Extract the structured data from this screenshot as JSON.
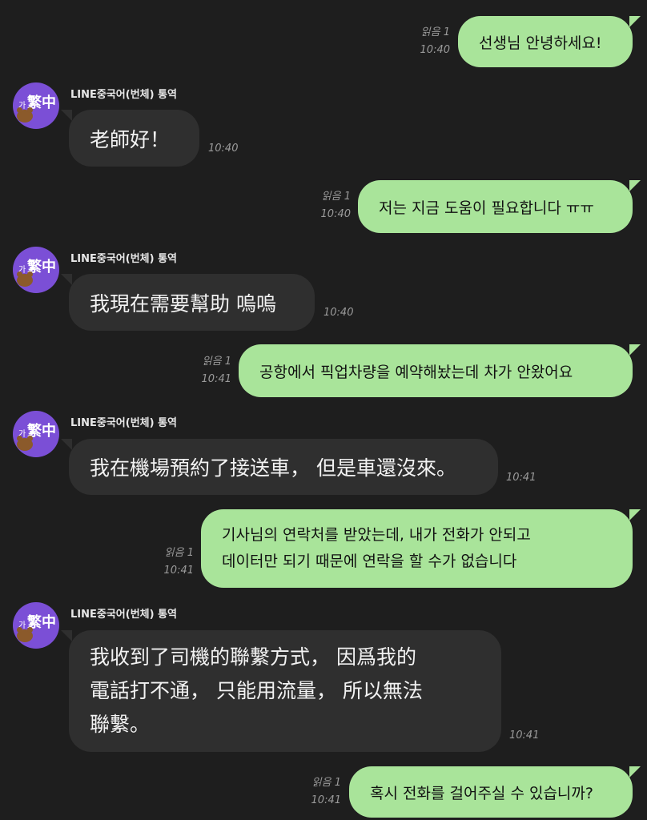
{
  "colors": {
    "background": "#1e1e1e",
    "outgoing_bubble": "#a9e49a",
    "incoming_bubble": "#2f2f2f",
    "avatar": "#7b4fd6"
  },
  "sender": {
    "name": "LINE중국어(번체) 통역",
    "avatar_badge": "가",
    "avatar_char": "繁中"
  },
  "messages": [
    {
      "dir": "out",
      "text": "선생님 안녕하세요!",
      "read": "읽음 1",
      "time": "10:40"
    },
    {
      "dir": "in",
      "text": "老師好！",
      "time": "10:40"
    },
    {
      "dir": "out",
      "text": "저는 지금 도움이 필요합니다 ㅠㅠ",
      "read": "읽음 1",
      "time": "10:40"
    },
    {
      "dir": "in",
      "text": "我現在需要幫助 嗚嗚",
      "time": "10:40"
    },
    {
      "dir": "out",
      "text": "공항에서 픽업차량을 예약해놨는데 차가 안왔어요",
      "read": "읽음 1",
      "time": "10:41"
    },
    {
      "dir": "in",
      "text": "我在機場預約了接送車， 但是車還沒來。",
      "time": "10:41"
    },
    {
      "dir": "out",
      "lines": [
        "기사님의 연락처를 받았는데, 내가 전화가 안되고",
        "데이터만 되기 때문에 연락을 할 수가 없습니다"
      ],
      "read": "읽음 1",
      "time": "10:41"
    },
    {
      "dir": "in",
      "lines": [
        "我收到了司機的聯繫方式， 因爲我的",
        "電話打不通， 只能用流量， 所以無法",
        "聯繫。"
      ],
      "time": "10:41"
    },
    {
      "dir": "out",
      "text": "혹시 전화를 걸어주실 수 있습니까?",
      "read": "읽음 1",
      "time": "10:41"
    }
  ]
}
